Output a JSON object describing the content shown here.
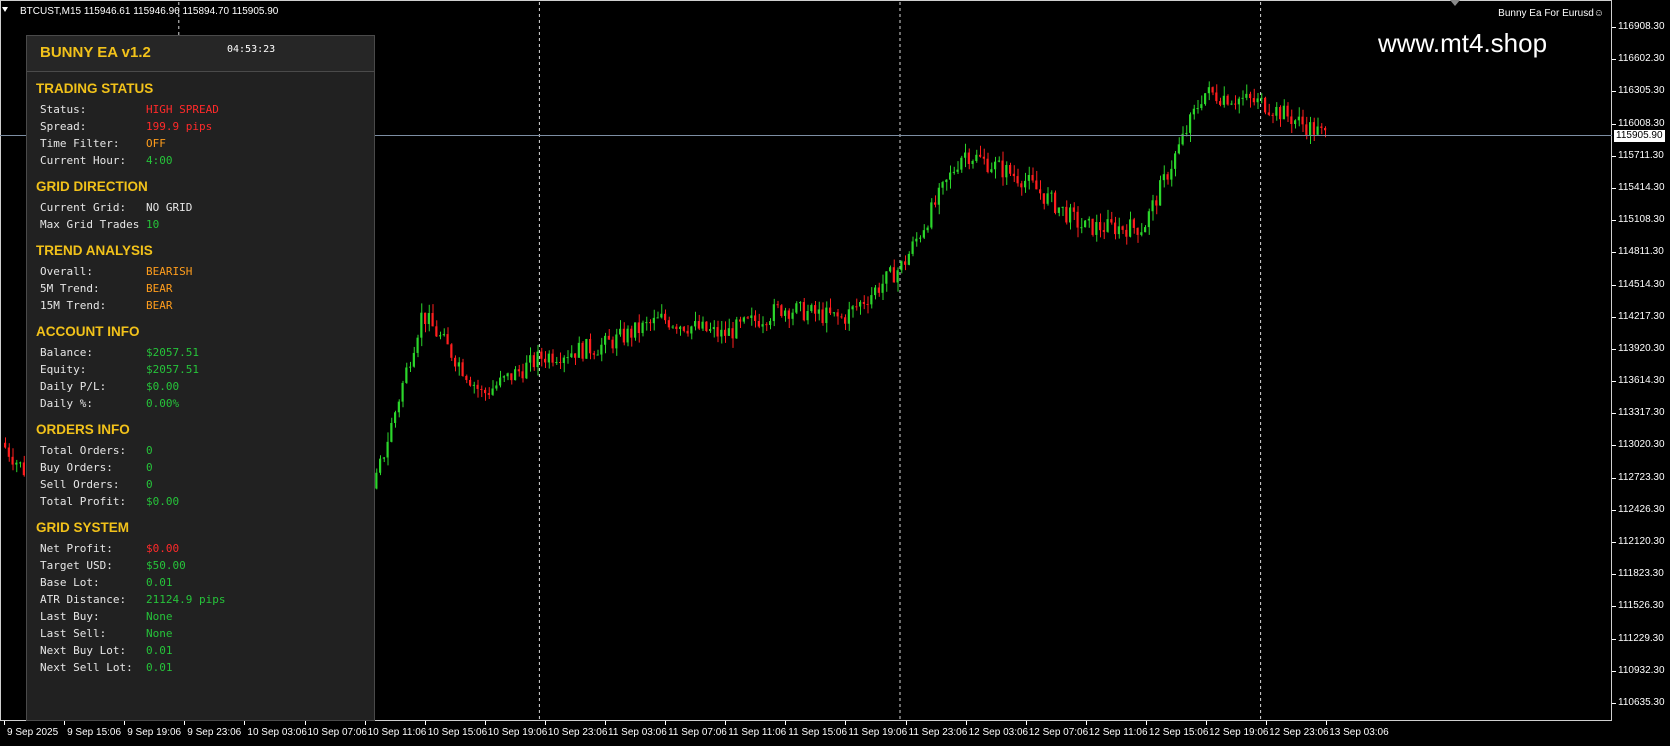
{
  "header": {
    "symbol_info": "BTCUST,M15  115946.61 115946.96 115894.70 115905.90",
    "ea_label": "Bunny Ea For Eurusd",
    "smiley": "☺",
    "watermark": "www.mt4.shop"
  },
  "price_axis": {
    "ticks": [
      "116908.30",
      "116602.30",
      "116305.30",
      "116008.30",
      "115711.30",
      "115414.30",
      "115108.30",
      "114811.30",
      "114514.30",
      "114217.30",
      "113920.30",
      "113614.30",
      "113317.30",
      "113020.30",
      "112723.30",
      "112426.30",
      "112120.30",
      "111823.30",
      "111526.30",
      "111229.30",
      "110932.30",
      "110635.30"
    ],
    "current_price": "115905.90",
    "current_price_value": 115905.9
  },
  "time_axis": {
    "labels": [
      "9 Sep 2025",
      "9 Sep 15:06",
      "9 Sep 19:06",
      "9 Sep 23:06",
      "10 Sep 03:06",
      "10 Sep 07:06",
      "10 Sep 11:06",
      "10 Sep 15:06",
      "10 Sep 19:06",
      "10 Sep 23:06",
      "11 Sep 03:06",
      "11 Sep 07:06",
      "11 Sep 11:06",
      "11 Sep 15:06",
      "11 Sep 19:06",
      "11 Sep 23:06",
      "12 Sep 03:06",
      "12 Sep 07:06",
      "12 Sep 11:06",
      "12 Sep 15:06",
      "12 Sep 19:06",
      "12 Sep 23:06",
      "13 Sep 03:06"
    ]
  },
  "colors": {
    "bull": "#2bd62b",
    "bear": "#ff1e1e",
    "background": "#000000",
    "accent": "#f2c21a"
  },
  "chart_data": {
    "type": "candlestick",
    "symbol": "BTCUST",
    "timeframe": "M15",
    "ylim": [
      110635.3,
      116908.3
    ],
    "current_price": 115905.9,
    "path_points": [
      {
        "t": "9 Sep 2025",
        "price": 113050
      },
      {
        "t": "9 Sep 19:06",
        "price": 111700
      },
      {
        "t": "9 Sep 23:06",
        "price": 112350
      },
      {
        "t": "10 Sep 03:06",
        "price": 112900
      },
      {
        "t": "10 Sep 07:06",
        "price": 113900
      },
      {
        "t": "10 Sep 11:06",
        "price": 112220
      },
      {
        "t": "10 Sep 15:06",
        "price": 114250
      },
      {
        "t": "10 Sep 19:06",
        "price": 113500
      },
      {
        "t": "10 Sep 23:06",
        "price": 113850
      },
      {
        "t": "11 Sep 03:06",
        "price": 113950
      },
      {
        "t": "11 Sep 07:06",
        "price": 114200
      },
      {
        "t": "11 Sep 11:06",
        "price": 114050
      },
      {
        "t": "11 Sep 15:06",
        "price": 114300
      },
      {
        "t": "11 Sep 19:06",
        "price": 114200
      },
      {
        "t": "11 Sep 23:06",
        "price": 114700
      },
      {
        "t": "12 Sep 03:06",
        "price": 115750
      },
      {
        "t": "12 Sep 07:06",
        "price": 115500
      },
      {
        "t": "12 Sep 11:06",
        "price": 115050
      },
      {
        "t": "12 Sep 15:06",
        "price": 115050
      },
      {
        "t": "12 Sep 19:06",
        "price": 116300
      },
      {
        "t": "12 Sep 23:06",
        "price": 116200
      },
      {
        "t": "13 Sep 03:06",
        "price": 115906
      }
    ]
  },
  "panel": {
    "title": "BUNNY EA v1.2",
    "clock": "04:53:23",
    "sections": [
      {
        "title": "TRADING STATUS",
        "rows": [
          {
            "label": "Status:",
            "value": "HIGH SPREAD",
            "color": "red"
          },
          {
            "label": "Spread:",
            "value": "199.9 pips",
            "color": "red"
          },
          {
            "label": "Time Filter:",
            "value": "OFF",
            "color": "orange"
          },
          {
            "label": "Current Hour:",
            "value": "4:00",
            "color": "green"
          }
        ]
      },
      {
        "title": "GRID DIRECTION",
        "rows": [
          {
            "label": "Current Grid:",
            "value": "NO GRID",
            "color": "white"
          },
          {
            "label": "Max Grid Trades",
            "value": "10",
            "color": "green"
          }
        ]
      },
      {
        "title": "TREND ANALYSIS",
        "rows": [
          {
            "label": "Overall:",
            "value": "BEARISH",
            "color": "orange"
          },
          {
            "label": "5M Trend:",
            "value": "BEAR",
            "color": "orange"
          },
          {
            "label": "15M Trend:",
            "value": "BEAR",
            "color": "orange"
          }
        ]
      },
      {
        "title": "ACCOUNT INFO",
        "rows": [
          {
            "label": "Balance:",
            "value": "$2057.51",
            "color": "green"
          },
          {
            "label": "Equity:",
            "value": "$2057.51",
            "color": "green"
          },
          {
            "label": "Daily P/L:",
            "value": "$0.00",
            "color": "green"
          },
          {
            "label": "Daily %:",
            "value": "0.00%",
            "color": "green"
          }
        ]
      },
      {
        "title": "ORDERS INFO",
        "rows": [
          {
            "label": "Total Orders:",
            "value": "0",
            "color": "green"
          },
          {
            "label": "Buy Orders:",
            "value": "0",
            "color": "green"
          },
          {
            "label": "Sell Orders:",
            "value": "0",
            "color": "green"
          },
          {
            "label": "Total Profit:",
            "value": "$0.00",
            "color": "green"
          }
        ]
      },
      {
        "title": "GRID SYSTEM",
        "rows": [
          {
            "label": "Net Profit:",
            "value": "$0.00",
            "color": "red"
          },
          {
            "label": "Target USD:",
            "value": "$50.00",
            "color": "green"
          },
          {
            "label": "Base Lot:",
            "value": "0.01",
            "color": "green"
          },
          {
            "label": "ATR Distance:",
            "value": "21124.9 pips",
            "color": "green"
          },
          {
            "label": "Last Buy:",
            "value": "None",
            "color": "green"
          },
          {
            "label": "Last Sell:",
            "value": "None",
            "color": "green"
          },
          {
            "label": "Next Buy Lot:",
            "value": "0.01",
            "color": "green"
          },
          {
            "label": "Next Sell Lot:",
            "value": "0.01",
            "color": "green"
          }
        ]
      }
    ]
  }
}
